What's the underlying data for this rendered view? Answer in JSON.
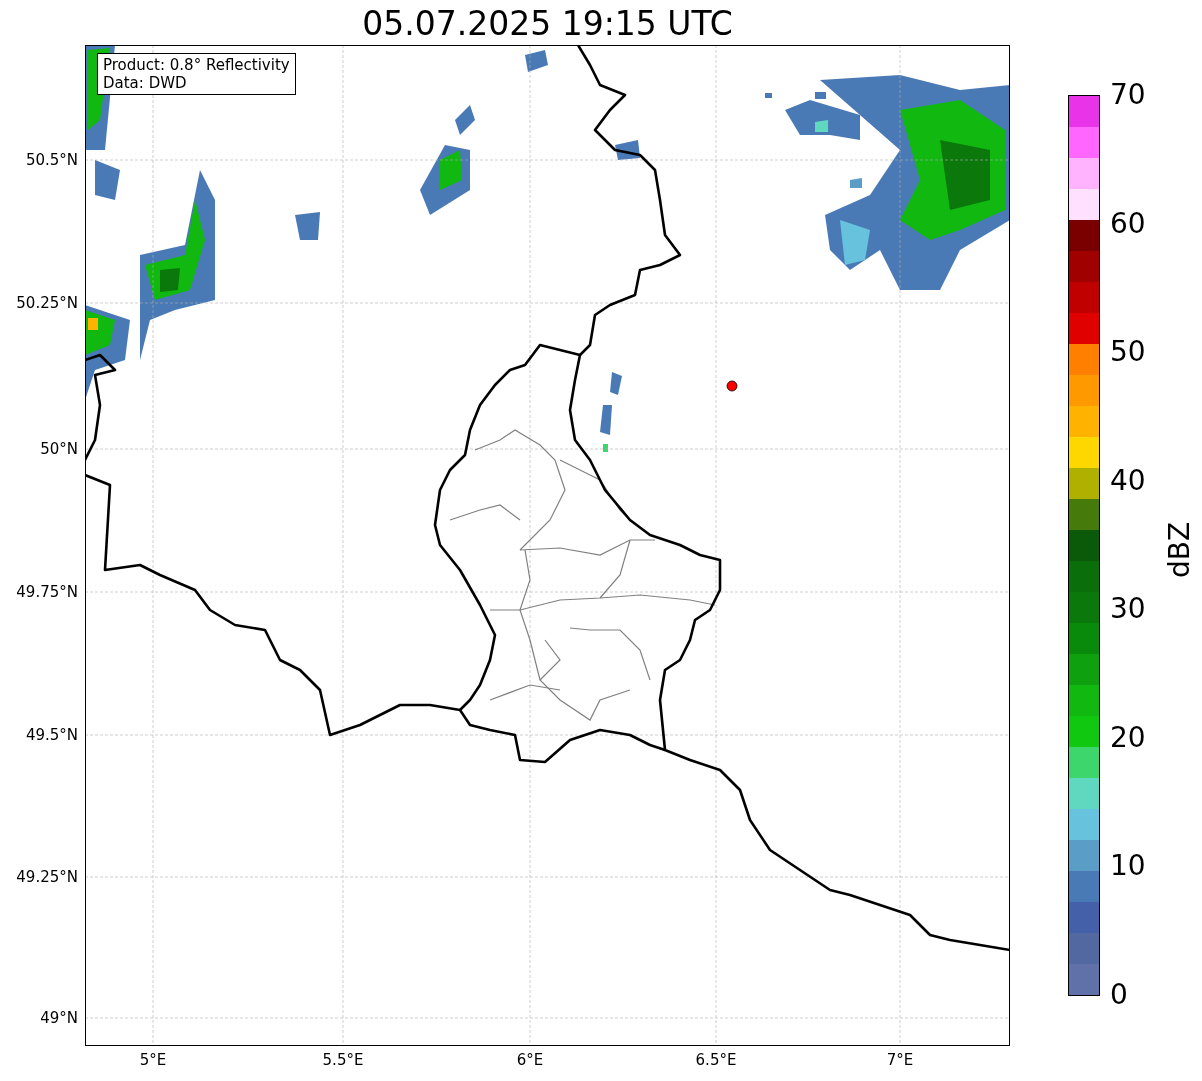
{
  "title": "05.07.2025 19:15 UTC",
  "info_box": {
    "lines": [
      "Product: 0.8° Reflectivity",
      "Data: DWD"
    ]
  },
  "x_axis": {
    "ticks": [
      "5°E",
      "5.5°E",
      "6°E",
      "6.5°E",
      "7°E"
    ]
  },
  "y_axis": {
    "ticks": [
      "50.5°N",
      "50.25°N",
      "50°N",
      "49.75°N",
      "49.5°N",
      "49.25°N",
      "49°N"
    ]
  },
  "colorbar": {
    "label": "dBZ",
    "ticks": [
      "70",
      "60",
      "50",
      "40",
      "30",
      "20",
      "10",
      "0"
    ],
    "bands": [
      {
        "color": "#e833e8"
      },
      {
        "color": "#ff66ff"
      },
      {
        "color": "#ffb3ff"
      },
      {
        "color": "#ffe0ff"
      },
      {
        "color": "#7a0000"
      },
      {
        "color": "#a00000"
      },
      {
        "color": "#c00000"
      },
      {
        "color": "#e00000"
      },
      {
        "color": "#ff7f00"
      },
      {
        "color": "#ff9900"
      },
      {
        "color": "#ffb300"
      },
      {
        "color": "#ffd700"
      },
      {
        "color": "#b0b000"
      },
      {
        "color": "#467a0a"
      },
      {
        "color": "#0a5a0a"
      },
      {
        "color": "#0a6e0a"
      },
      {
        "color": "#0a780a"
      },
      {
        "color": "#0a8a0a"
      },
      {
        "color": "#0fa00f"
      },
      {
        "color": "#10b810"
      },
      {
        "color": "#10c810"
      },
      {
        "color": "#3dd66d"
      },
      {
        "color": "#60d8c0"
      },
      {
        "color": "#66c2dd"
      },
      {
        "color": "#5a9ec8"
      },
      {
        "color": "#4a7ab5"
      },
      {
        "color": "#4460a8"
      },
      {
        "color": "#5268a0"
      },
      {
        "color": "#6070a8"
      }
    ]
  }
}
